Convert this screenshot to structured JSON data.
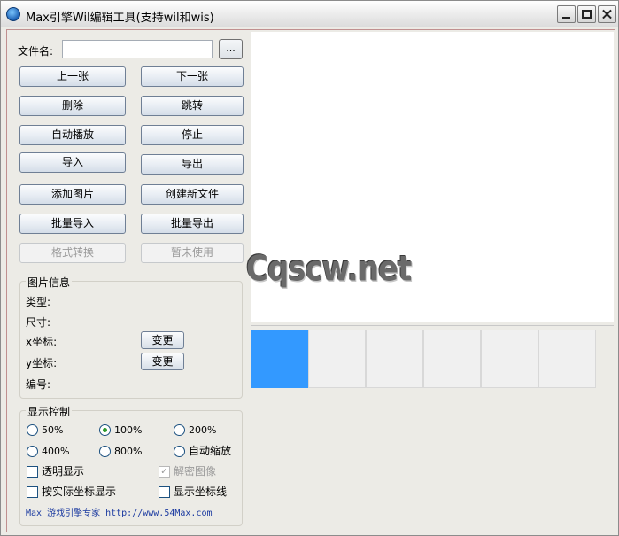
{
  "window": {
    "title": "Max引擎Wil编辑工具(支持wil和wis)"
  },
  "file": {
    "label": "文件名:",
    "value": "",
    "browse_label": "..."
  },
  "buttons": {
    "prev": "上一张",
    "next": "下一张",
    "delete": "删除",
    "jump": "跳转",
    "autoplay": "自动播放",
    "stop": "停止",
    "import": "导入",
    "export": "导出",
    "add_image": "添加图片",
    "create_file": "创建新文件",
    "batch_import": "批量导入",
    "batch_export": "批量导出",
    "format_convert": "格式转换",
    "not_in_use": "暂未使用"
  },
  "image_info": {
    "title": "图片信息",
    "type_label": "类型:",
    "size_label": "尺寸:",
    "x_label": "x坐标:",
    "y_label": "y坐标:",
    "id_label": "编号:",
    "change_label": "变更"
  },
  "display": {
    "title": "显示控制",
    "zoom_options": [
      "50%",
      "100%",
      "200%",
      "400%",
      "800%",
      "自动缩放"
    ],
    "selected_zoom": "100%",
    "transparent": "透明显示",
    "decrypt": "解密图像",
    "actual_coords": "按实际坐标显示",
    "show_axis": "显示坐标线"
  },
  "footer": {
    "text": "Max 游戏引擎专家 http://www.54Max.com"
  },
  "watermark": "Cqscw.net",
  "colors": {
    "selected_thumb": "#3399ff",
    "footer_text": "#1b3aa0"
  }
}
